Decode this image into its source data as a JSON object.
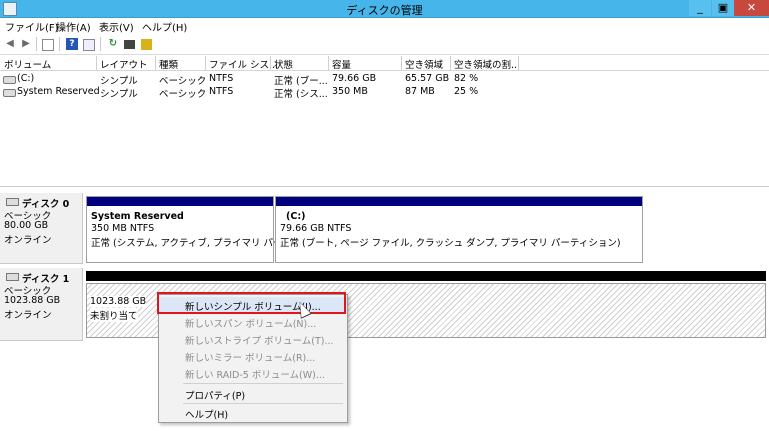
{
  "window": {
    "title": "ディスクの管理",
    "minimize": "_",
    "maximize": "▣",
    "close": "✕"
  },
  "menu": [
    "ファイル(F)",
    "操作(A)",
    "表示(V)",
    "ヘルプ(H)"
  ],
  "toolbar_icons": [
    "back-arrow-icon",
    "forward-arrow-icon",
    "console-tree-icon",
    "help-icon",
    "action-pane-icon",
    "refresh-icon",
    "properties-icon",
    "map-icon"
  ],
  "columns": [
    "ボリューム",
    "レイアウト",
    "種類",
    "ファイル シス...",
    "状態",
    "容量",
    "空き領域",
    "空き領域の割..."
  ],
  "volumes": [
    {
      "name": "(C:)",
      "layout": "シンプル",
      "type": "ベーシック",
      "fs": "NTFS",
      "status": "正常 (ブー...",
      "capacity": "79.66 GB",
      "free": "65.57 GB",
      "pct": "82 %"
    },
    {
      "name": "System Reserved",
      "layout": "シンプル",
      "type": "ベーシック",
      "fs": "NTFS",
      "status": "正常 (シス...",
      "capacity": "350 MB",
      "free": "87 MB",
      "pct": "25 %"
    }
  ],
  "disk0": {
    "name": "ディスク 0",
    "type": "ベーシック",
    "size": "80.00 GB",
    "state": "オンライン",
    "partitions": [
      {
        "name": "System Reserved",
        "size": "350 MB NTFS",
        "status": "正常 (システム, アクティブ, プライマリ パーティション"
      },
      {
        "name": "(C:)",
        "size": "79.66 GB NTFS",
        "status": "正常 (ブート, ページ ファイル, クラッシュ ダンプ, プライマリ パーティション)"
      }
    ]
  },
  "disk1": {
    "name": "ディスク 1",
    "type": "ベーシック",
    "size": "1023.88 GB",
    "state": "オンライン",
    "unallocated_size": "1023.88 GB",
    "unallocated_label": "未割り当て"
  },
  "context_menu": {
    "items": [
      {
        "label": "新しいシンプル ボリューム(I)...",
        "enabled": true
      },
      {
        "label": "新しいスパン ボリューム(N)...",
        "enabled": false
      },
      {
        "label": "新しいストライプ ボリューム(T)...",
        "enabled": false
      },
      {
        "label": "新しいミラー ボリューム(R)...",
        "enabled": false
      },
      {
        "label": "新しい RAID-5 ボリューム(W)...",
        "enabled": false
      },
      {
        "label": "プロパティ(P)",
        "enabled": true
      },
      {
        "label": "ヘルプ(H)",
        "enabled": true
      }
    ]
  },
  "colors": {
    "primary_partition": "#00007f",
    "unallocated": "#000000",
    "titlebar": "#46b5ea",
    "highlight": "#e0161b"
  }
}
